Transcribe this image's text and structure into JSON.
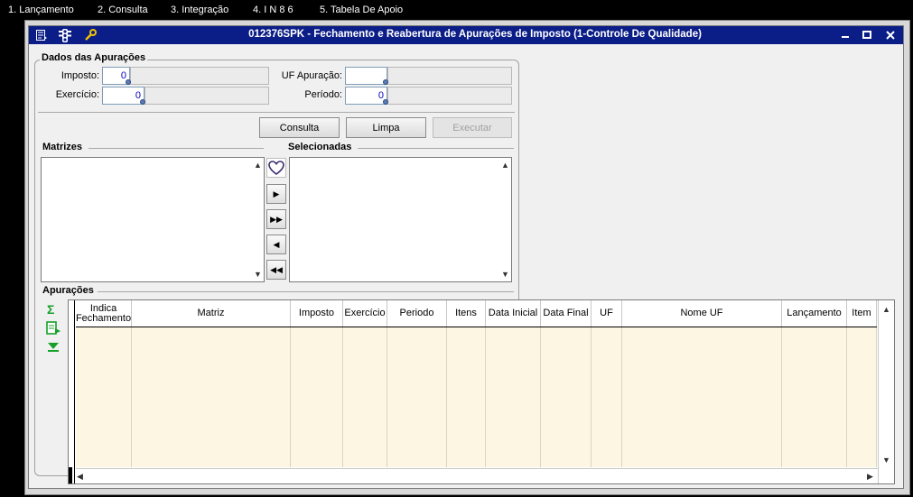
{
  "menu": [
    "1. Lançamento",
    "2. Consulta",
    "3. Integração",
    "4. I N  8 6",
    "5. Tabela De Apoio"
  ],
  "window": {
    "title": "012376SPK - Fechamento e Reabertura de Apurações de Imposto (1-Controle De Qualidade)",
    "icons": [
      "form-icon",
      "traffic-light-icon",
      "wrench-icon"
    ],
    "controls": [
      "minimize-icon",
      "maximize-icon",
      "close-icon"
    ]
  },
  "dados": {
    "title": "Dados das Apurações",
    "imposto_label": "Imposto:",
    "imposto_value": "0",
    "exercicio_label": "Exercício:",
    "exercicio_value": "0",
    "uf_label": "UF Apuração:",
    "uf_value": "",
    "periodo_label": "Período:",
    "periodo_value": "0"
  },
  "buttons": {
    "consulta": "Consulta",
    "limpa": "Limpa",
    "executar": "Executar"
  },
  "matrizes_label": "Matrizes",
  "selecionadas_label": "Selecionadas",
  "apuracoes_label": "Apurações",
  "grid_columns": [
    "Indica Fechamento",
    "Matriz",
    "Imposto",
    "Exercício",
    "Periodo",
    "Itens",
    "Data Inicial",
    "Data Final",
    "UF",
    "Nome UF",
    "Lançamento",
    "Item"
  ],
  "colors": {
    "titlebar": "#0b1d87",
    "grid_row_bg": "#fdf6e3",
    "accent_green": "#16a02a"
  }
}
